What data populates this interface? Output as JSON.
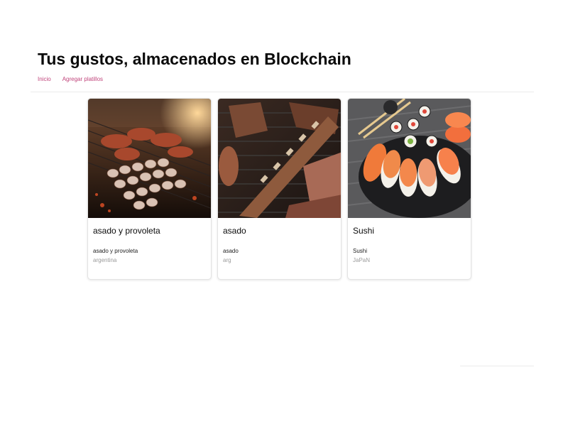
{
  "header": {
    "title": "Tus gustos, almacenados en Blockchain",
    "nav": [
      {
        "label": "Inicio"
      },
      {
        "label": "Agregar platillos"
      }
    ]
  },
  "cards": [
    {
      "title": "asado y provoleta",
      "description": "asado y provoleta",
      "origin": "argentina",
      "image": "grilled-sausages-and-meats-photo"
    },
    {
      "title": "asado",
      "description": "asado",
      "origin": "arg",
      "image": "grilled-ribs-photo"
    },
    {
      "title": "Sushi",
      "description": "Sushi",
      "origin": "JaPaN",
      "image": "sushi-platter-photo"
    }
  ]
}
